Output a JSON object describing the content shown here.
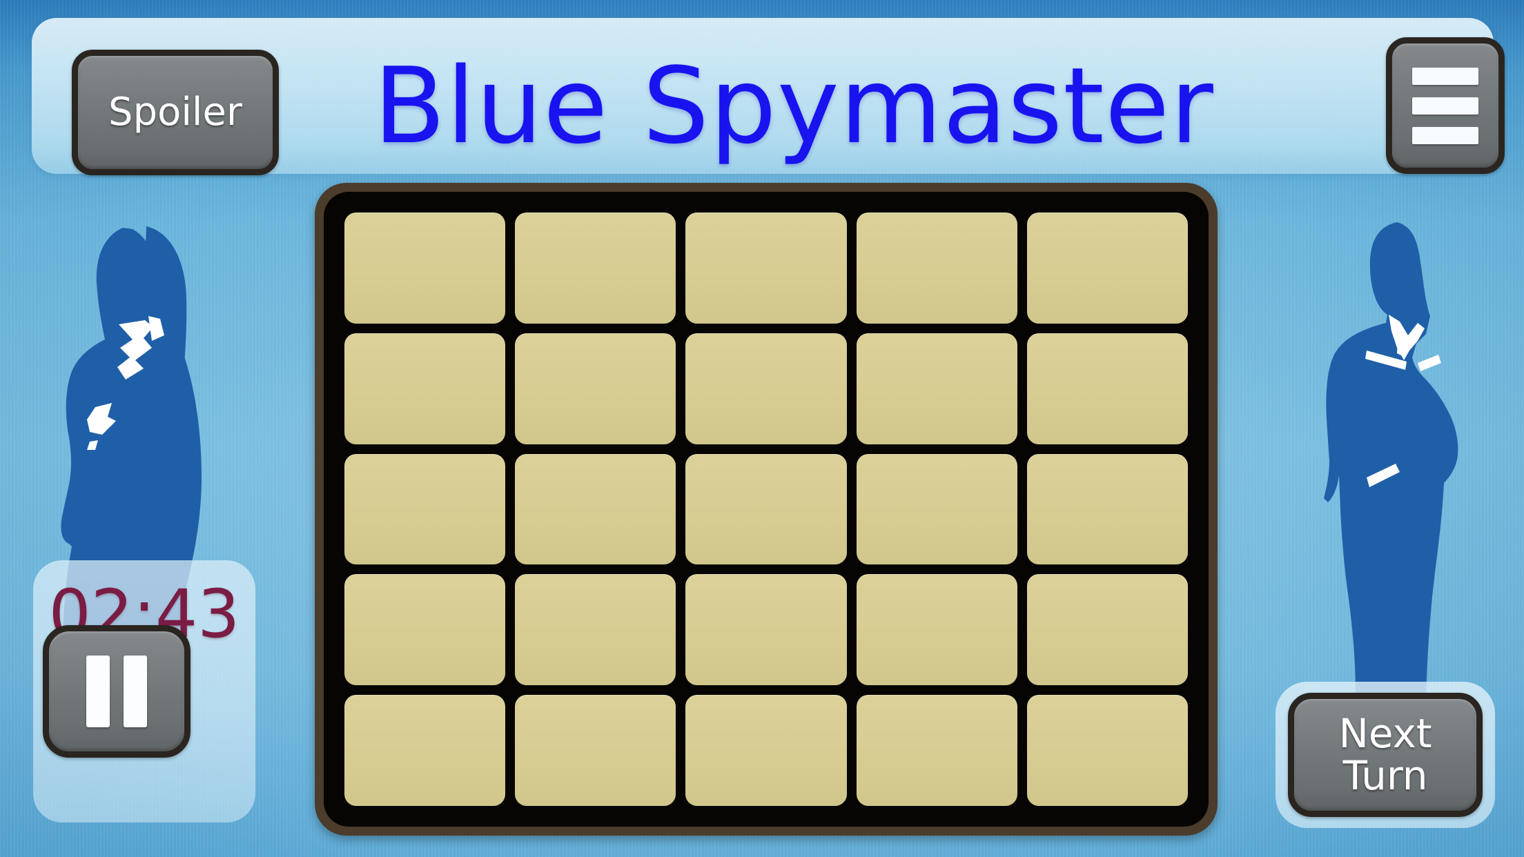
{
  "header": {
    "title": "Blue Spymaster",
    "title_color": "#1913F0",
    "spoiler_button": "Spoiler",
    "menu_icon": "hamburger-menu-icon"
  },
  "timer": {
    "value": "02:43",
    "value_color": "#7A1C43",
    "pause_icon": "pause-icon"
  },
  "actions": {
    "next_turn": "Next\nTurn",
    "next_turn_line1": "Next",
    "next_turn_line2": "Turn"
  },
  "board": {
    "rows": 5,
    "columns": 5,
    "card_color": "#D7CC92",
    "frame_color": "#4B3C2B",
    "inner_color": "#060504",
    "cards": [
      "",
      "",
      "",
      "",
      "",
      "",
      "",
      "",
      "",
      "",
      "",
      "",
      "",
      "",
      "",
      "",
      "",
      "",
      "",
      "",
      "",
      "",
      "",
      "",
      ""
    ]
  },
  "decor": {
    "left_silhouette": "female-spy-silhouette",
    "right_silhouette": "male-spy-silhouette",
    "silhouette_color": "#1F5FA8",
    "background_color": "#6AB6DD"
  }
}
